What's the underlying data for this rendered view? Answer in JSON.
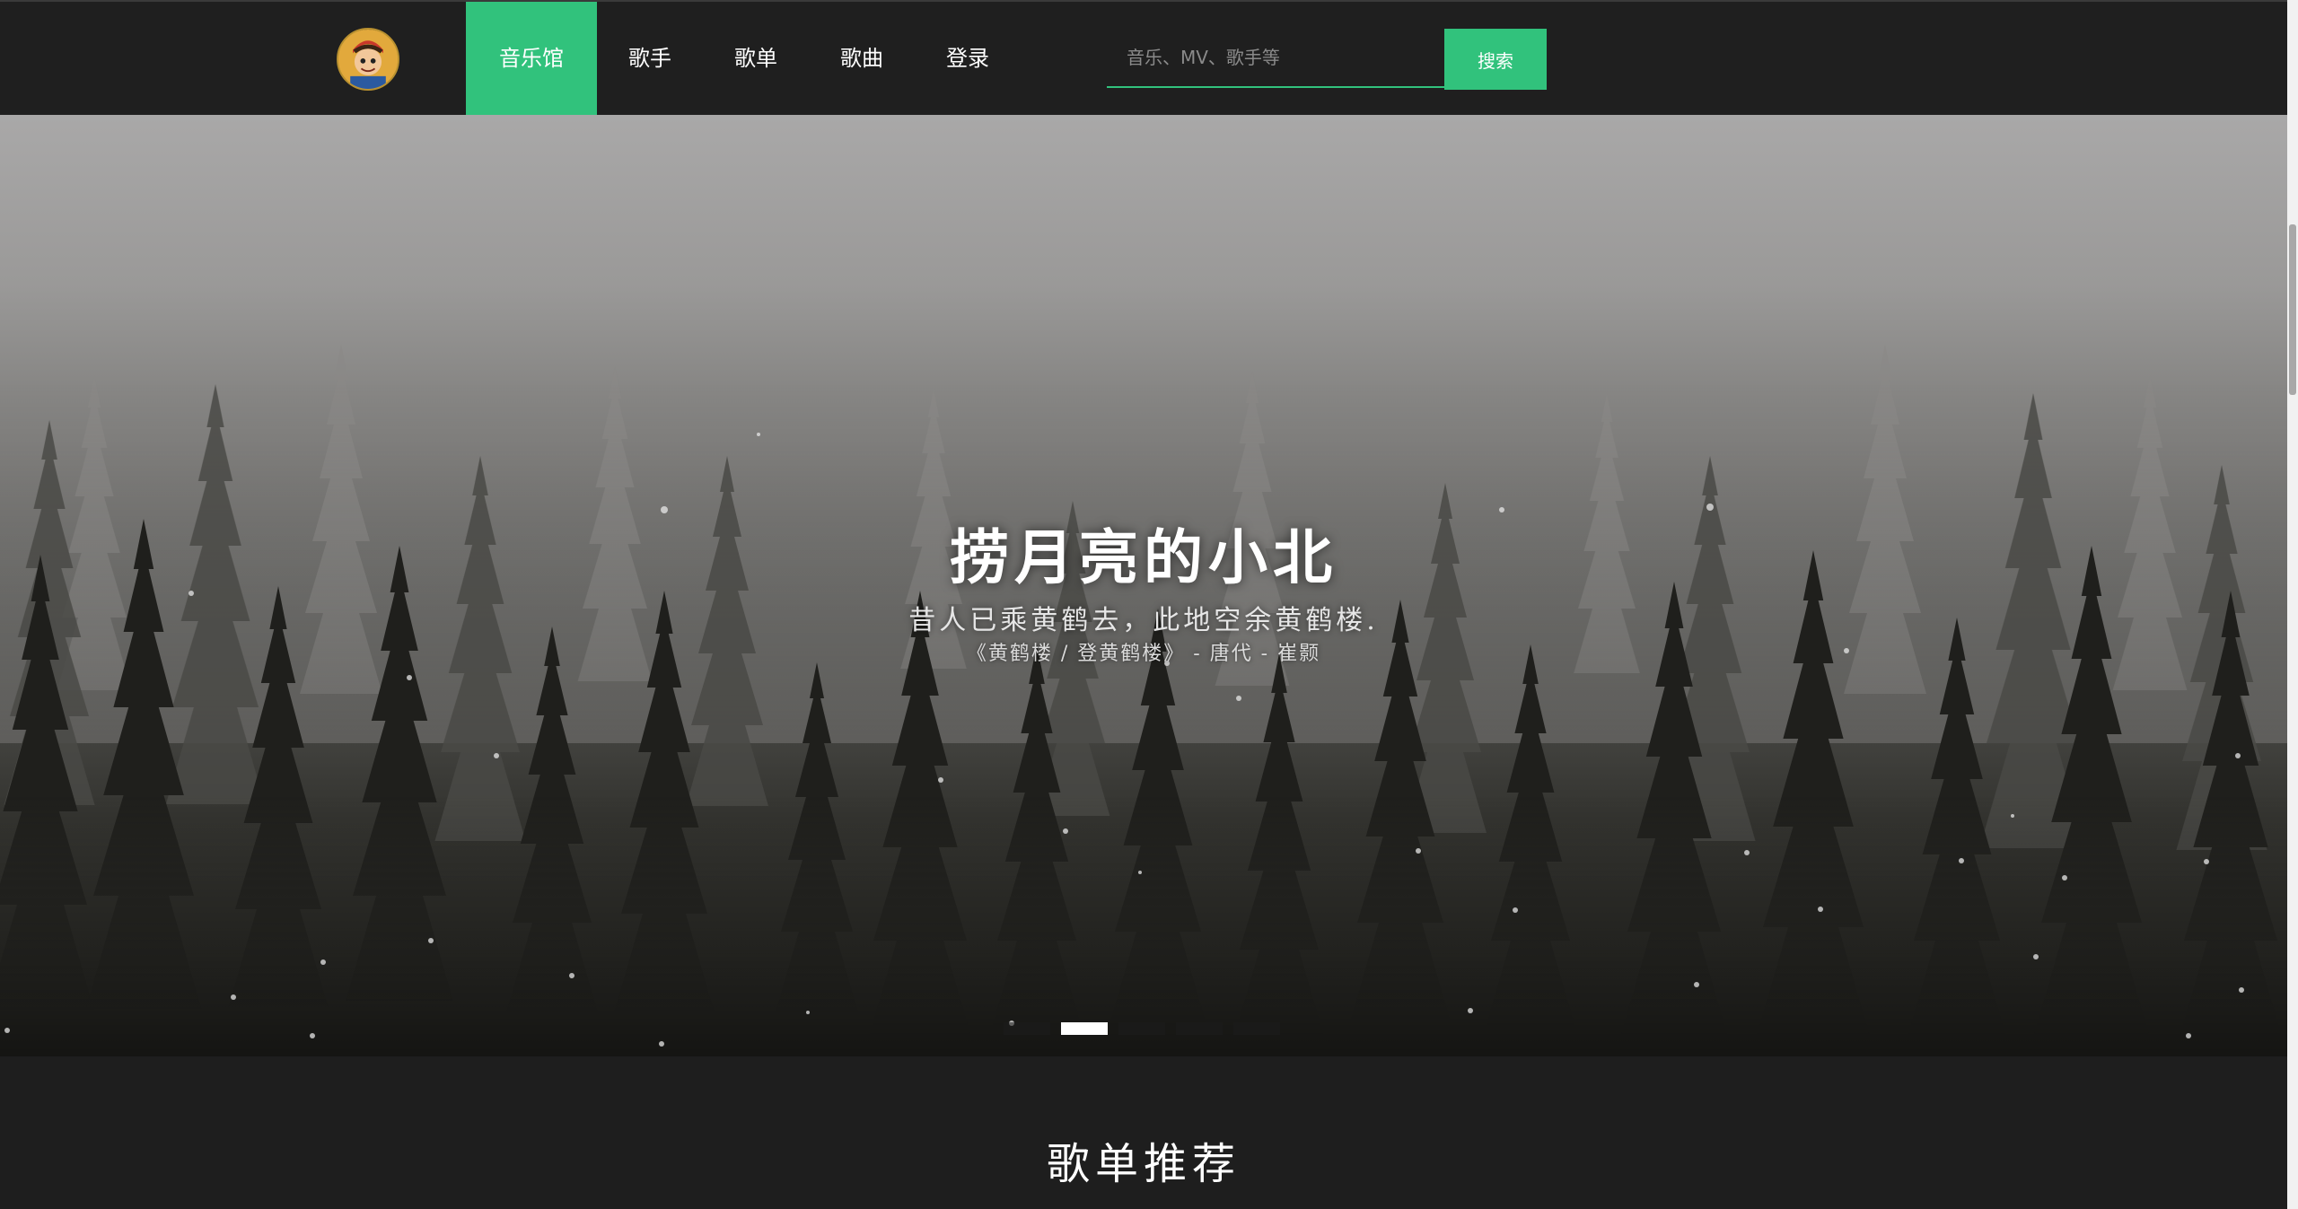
{
  "header": {
    "logo_alt": "avatar logo",
    "nav": [
      {
        "label": "音乐馆",
        "active": true
      },
      {
        "label": "歌手",
        "active": false
      },
      {
        "label": "歌单",
        "active": false
      },
      {
        "label": "歌曲",
        "active": false
      },
      {
        "label": "登录",
        "active": false
      }
    ],
    "search": {
      "placeholder": "音乐、MV、歌手等",
      "value": "",
      "button_label": "搜索"
    }
  },
  "hero": {
    "title": "捞月亮的小北",
    "verse": "昔人已乘黄鹤去，此地空余黄鹤楼.",
    "source": "《黄鹤楼 / 登黄鹤楼》 - 唐代 - 崔颢",
    "slides": 5,
    "active_slide": 2
  },
  "section": {
    "title": "歌单推荐"
  },
  "colors": {
    "accent": "#31c27c",
    "header_bg": "#1f1f1f",
    "page_bg": "#1e1e1e"
  }
}
